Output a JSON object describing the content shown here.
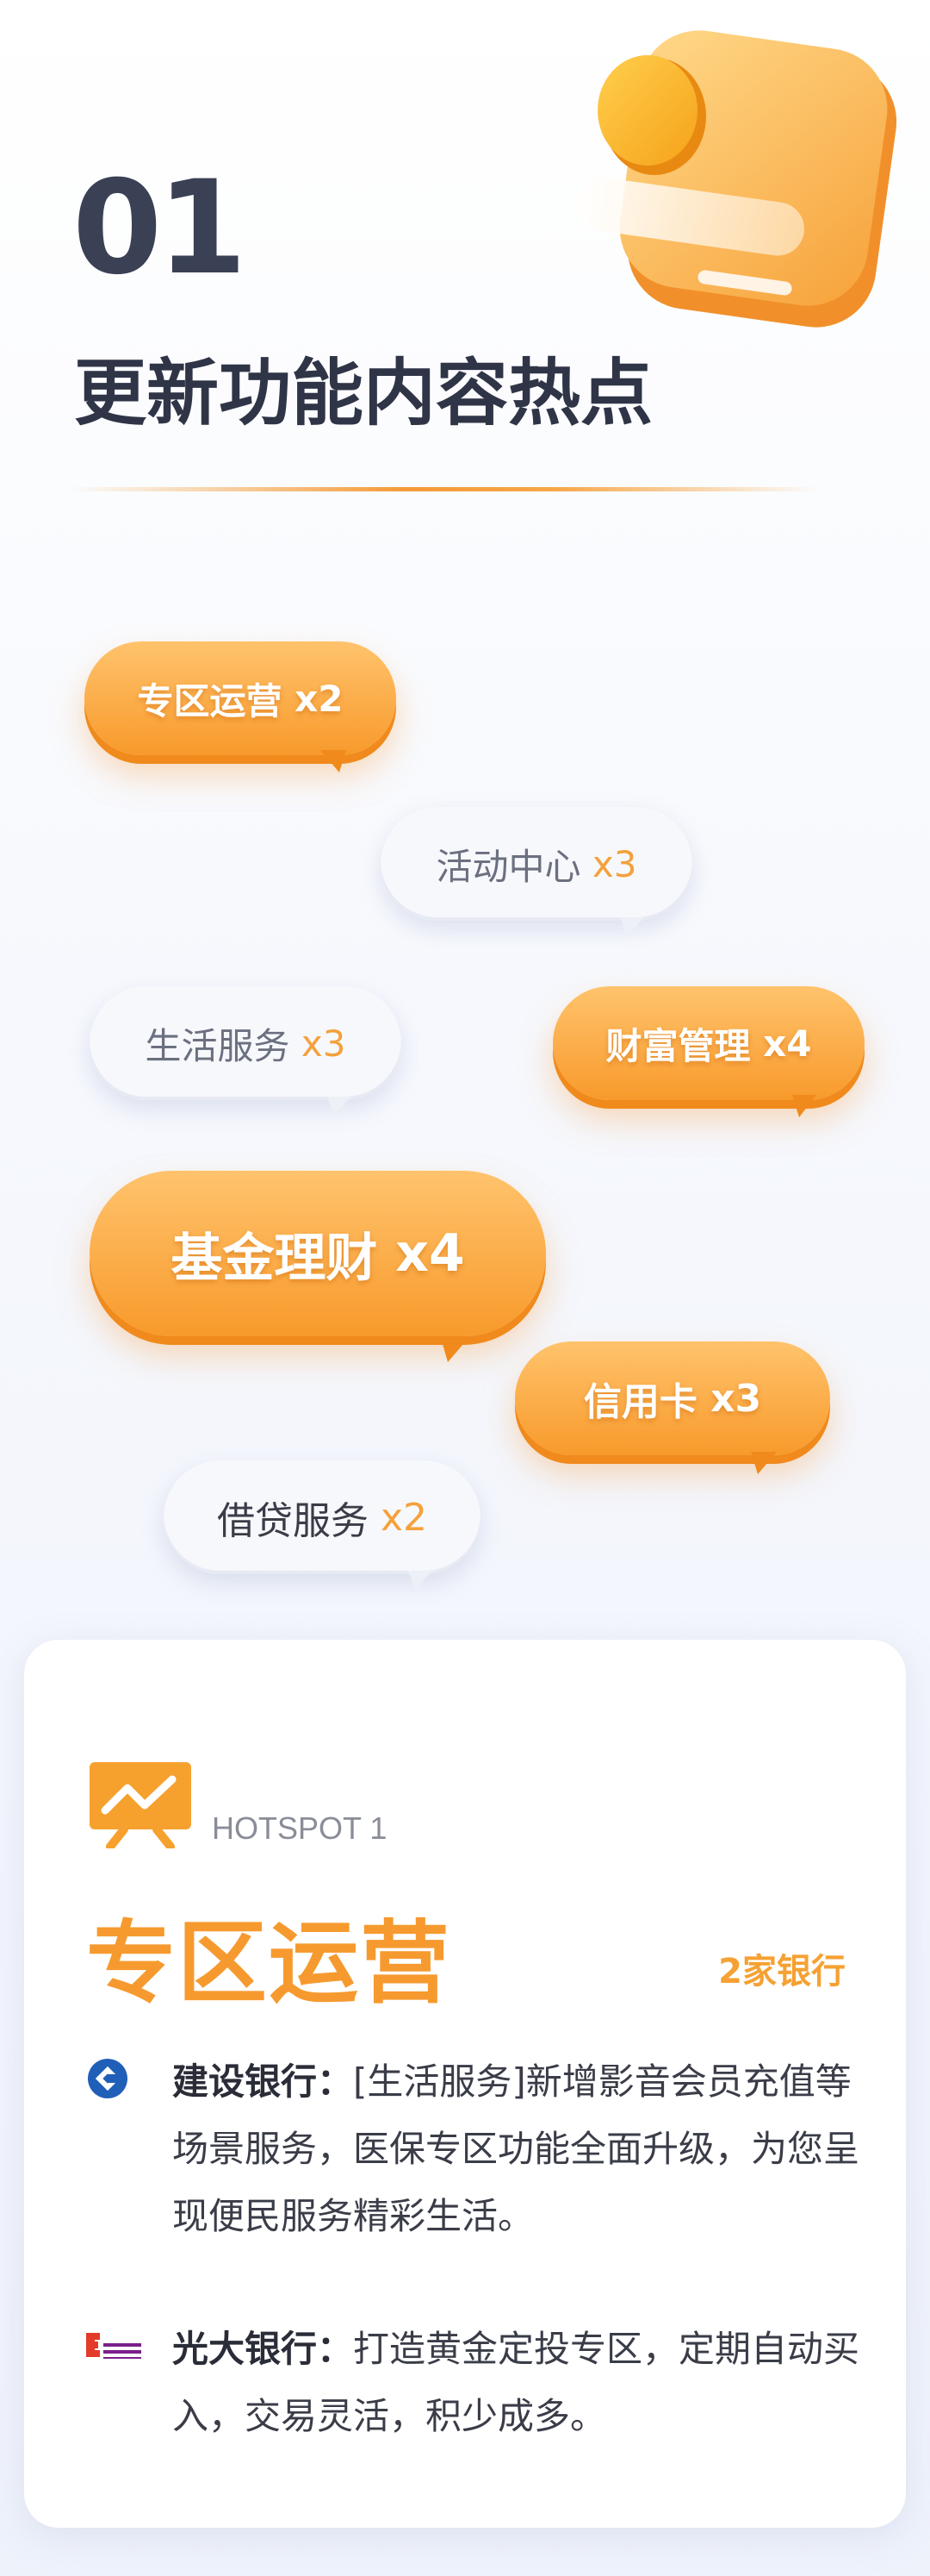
{
  "header": {
    "number": "01",
    "title": "更新功能内容热点"
  },
  "tags": [
    {
      "label": "专区运营",
      "count": "x2",
      "style": "orange"
    },
    {
      "label": "活动中心",
      "count": "x3",
      "style": "white"
    },
    {
      "label": "生活服务",
      "count": "x3",
      "style": "white"
    },
    {
      "label": "财富管理",
      "count": "x4",
      "style": "orange"
    },
    {
      "label": "基金理财",
      "count": "x4",
      "style": "orange"
    },
    {
      "label": "信用卡",
      "count": "x3",
      "style": "orange"
    },
    {
      "label": "借贷服务",
      "count": "x2",
      "style": "white"
    }
  ],
  "hotspot": {
    "label": "HOTSPOT 1",
    "title": "专区运营",
    "count": "2家银行",
    "icon": "chart-trend-icon",
    "banks": [
      {
        "name": "建设银行：",
        "desc": "[生活服务]新增影音会员充值等场景服务，医保专区功能全面升级，为您呈现便民服务精彩生活。",
        "logo": "ccb-logo-icon",
        "logo_color": "#1f5fb8"
      },
      {
        "name": "光大银行：",
        "desc": "打造黄金定投专区，定期自动买入，交易灵活，积少成多。",
        "logo": "ceb-bank-logo-icon",
        "logo_color": "#7a1f8c"
      }
    ]
  },
  "colors": {
    "accent": "#f69a2f",
    "text_dark": "#2f3547"
  }
}
